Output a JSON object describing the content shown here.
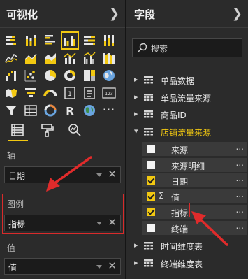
{
  "visualizations": {
    "title": "可视化",
    "collapse_icon": "chevron-right-icon",
    "selected_index": 3,
    "chart_icons": [
      "stacked-bar-icon",
      "stacked-column-icon",
      "clustered-bar-icon",
      "clustered-column-icon",
      "100-stacked-bar-icon",
      "100-stacked-column-icon",
      "line-chart-icon",
      "area-chart-icon",
      "stacked-area-icon",
      "line-column-icon",
      "line-clustered-column-icon",
      "ribbon-chart-icon",
      "waterfall-icon",
      "scatter-icon",
      "pie-icon",
      "donut-icon",
      "treemap-icon",
      "map-icon",
      "filled-map-icon",
      "funnel-icon",
      "gauge-icon",
      "card-icon",
      "multi-row-card-icon",
      "kpi-icon",
      "slicer-icon",
      "table-icon",
      "matrix-icon",
      "r-visual-icon",
      "globe-icon",
      "more-icon"
    ],
    "more_label": "···",
    "tabs": [
      "fields-tab-icon",
      "format-paint-roller-icon",
      "analytics-magnifier-icon"
    ],
    "wells": [
      {
        "label": "轴",
        "value": "日期"
      },
      {
        "label": "图例",
        "value": "指标"
      },
      {
        "label": "值",
        "value": "值"
      }
    ],
    "highlight_color": "#d92b2b",
    "accent": "#f2c811"
  },
  "fields": {
    "title": "字段",
    "collapse_icon": "chevron-right-icon",
    "search_placeholder": "搜索",
    "tables": [
      {
        "name": "单品数据",
        "expanded": false
      },
      {
        "name": "单品流量来源",
        "expanded": false
      },
      {
        "name": "商品ID",
        "expanded": false
      },
      {
        "name": "店铺流量来源",
        "expanded": true
      }
    ],
    "expanded_fields": [
      {
        "name": "来源",
        "checked": false,
        "sigma": ""
      },
      {
        "name": "来源明细",
        "checked": false,
        "sigma": ""
      },
      {
        "name": "日期",
        "checked": true,
        "sigma": ""
      },
      {
        "name": "值",
        "checked": true,
        "sigma": "Σ"
      },
      {
        "name": "指标",
        "checked": true,
        "sigma": ""
      },
      {
        "name": "终端",
        "checked": false,
        "sigma": ""
      }
    ],
    "more_tables": [
      {
        "name": "时间维度表",
        "expanded": false
      },
      {
        "name": "终端维度表",
        "expanded": false
      }
    ],
    "more_dots": "...",
    "expand_glyph": "▸",
    "expanded_glyph": "▾"
  }
}
